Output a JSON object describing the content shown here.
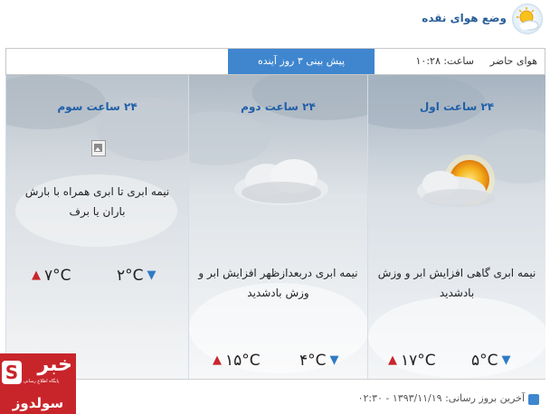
{
  "header": {
    "title": "وضع هوای نقده",
    "icon": "sun-cloud-icon"
  },
  "tabs": {
    "current": "هوای حاضر",
    "time": "ساعت: ۱۰:۲۸",
    "forecast": "پیش بینی ۳ روز آینده"
  },
  "panels": [
    {
      "title": "۲۴ ساعت اول",
      "description": "نیمه ابری گاهی افزایش ابر و وزش بادشدید",
      "high": "۱۷°C",
      "low": "۵°C",
      "icon": "partly-cloudy-sun-icon"
    },
    {
      "title": "۲۴ ساعت دوم",
      "description": "نیمه ابری دربعدازظهر افزایش ابر و وزش بادشدید",
      "high": "۱۵°C",
      "low": "۴°C",
      "icon": "cloud-icon"
    },
    {
      "title": "۲۴ ساعت سوم",
      "description": "نیمه ابری تا ابری همراه با بارش باران یا برف",
      "high": "۷°C",
      "low": "۲°C",
      "icon": "broken-image-icon"
    }
  ],
  "footer": {
    "text": "آخرین بروز رسانی: ۱۳۹۳/۱۱/۱۹ - ۰۲:۳۰",
    "icon": "info-icon"
  },
  "watermark": {
    "news": "خبر",
    "brand": "سولدوز",
    "tagline": "پایگاه اطلاع رسانی"
  },
  "colors": {
    "accent": "#3f86cf",
    "title_blue": "#1f5fa8",
    "high_arrow": "#c8252b",
    "low_arrow": "#2d7bc5",
    "logo_red": "#c8252b"
  }
}
